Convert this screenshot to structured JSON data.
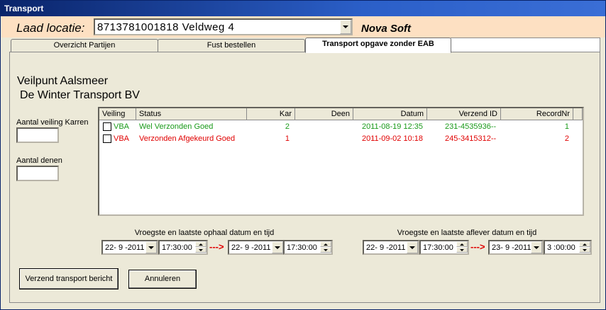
{
  "window": {
    "title": "Transport"
  },
  "header": {
    "laad_label": "Laad locatie:",
    "location_value": "8713781001818  Veldweg  4",
    "brand": "Nova Soft"
  },
  "tabs": [
    {
      "label": "Overzicht Partijen",
      "active": false
    },
    {
      "label": "Fust bestellen",
      "active": false
    },
    {
      "label": "Transport opgave zonder EAB",
      "active": true
    }
  ],
  "panel": {
    "title1": "Veilpunt Aalsmeer",
    "title2": "De Winter Transport BV",
    "aantal_karren_label": "Aantal veiling Karren",
    "aantal_karren_value": "",
    "aantal_denen_label": "Aantal denen",
    "aantal_denen_value": ""
  },
  "grid": {
    "columns": [
      "Veiling",
      "Status",
      "Kar",
      "Deen",
      "Datum",
      "Verzend ID",
      "RecordNr"
    ],
    "rows": [
      {
        "checked": false,
        "veiling": "VBA",
        "status": "Wel Verzonden Goed",
        "kar": "2",
        "deen": "",
        "datum": "2011-08-19 12:35",
        "verzend_id": "231-4535936--",
        "recordnr": "1",
        "color": "#1a9a1a"
      },
      {
        "checked": false,
        "veiling": "VBA",
        "status": "Verzonden Afgekeurd Goed",
        "kar": "1",
        "deen": "",
        "datum": "2011-09-02 10:18",
        "verzend_id": "245-3415312--",
        "recordnr": "2",
        "color": "#e00000"
      }
    ]
  },
  "ophaal": {
    "label": "Vroegste en laatste ophaal datum en tijd",
    "from_date": "22- 9 -2011",
    "from_time": "17:30:00",
    "to_date": "22- 9 -2011",
    "to_time": "17:30:00",
    "arrow": "--->"
  },
  "aflever": {
    "label": "Vroegste en laatste aflever datum en tijd",
    "from_date": "22- 9 -2011",
    "from_time": "17:30:00",
    "to_date": "23- 9 -2011",
    "to_time": "3 :00:00",
    "arrow": "--->"
  },
  "buttons": {
    "send": "Verzend transport bericht",
    "cancel": "Annuleren"
  },
  "colors": {
    "header_band": "#fde0c2",
    "ok_green": "#1a9a1a",
    "error_red": "#e00000"
  }
}
